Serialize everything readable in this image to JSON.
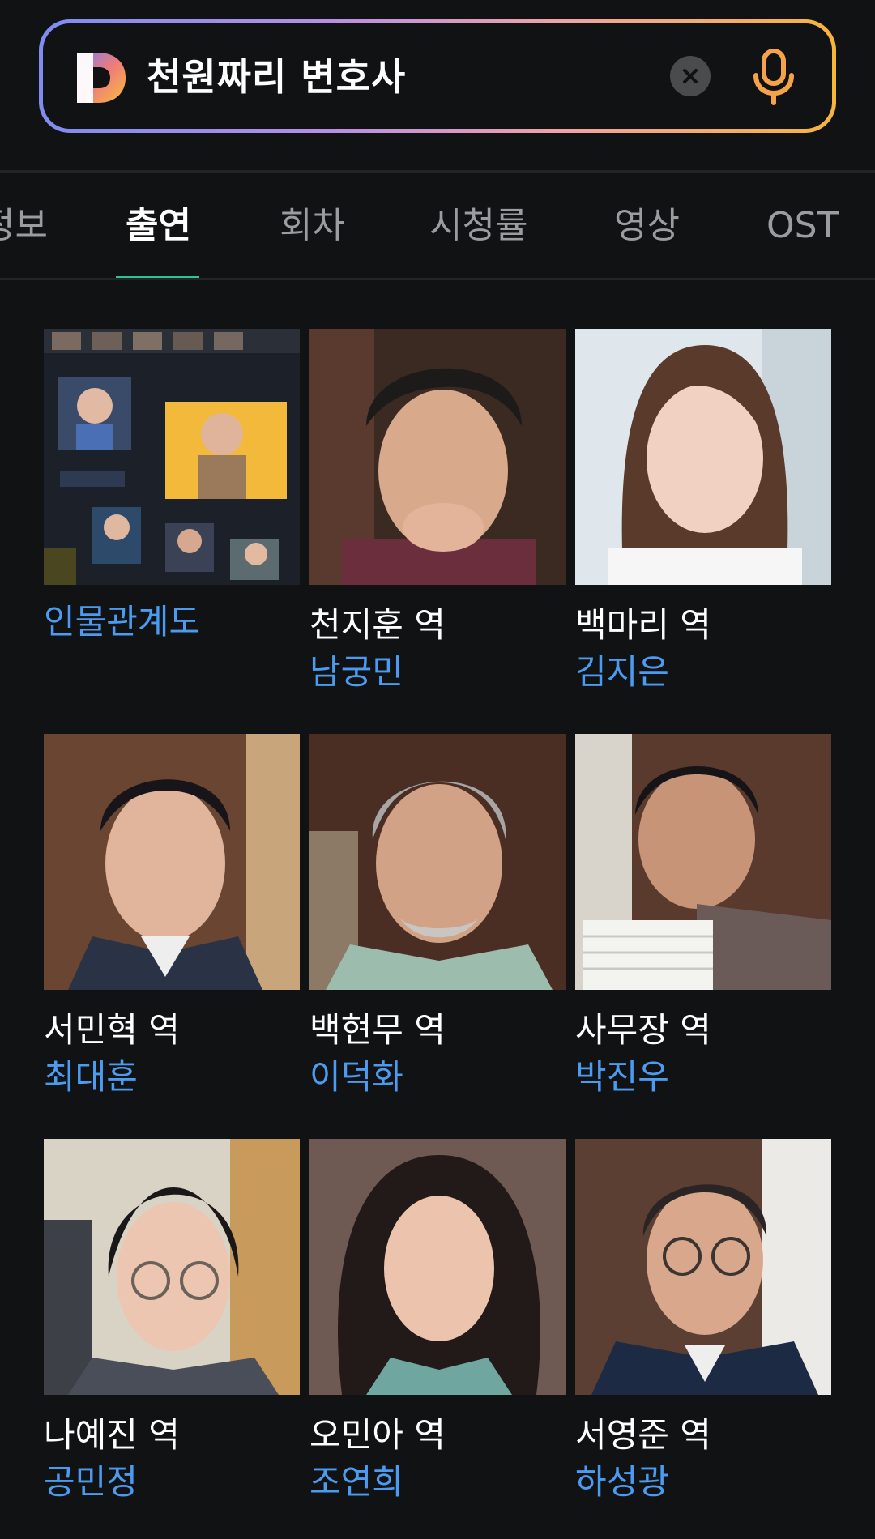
{
  "search": {
    "query": "천원짜리 변호사",
    "brand_colors": [
      "#7f8cf0",
      "#b58ee8",
      "#f0a2a8",
      "#f6b53c"
    ],
    "logo_icon": "daum-d-logo",
    "clear_icon": "close-icon",
    "mic_icon": "microphone-icon"
  },
  "tabs": [
    {
      "label": "정보",
      "active": false
    },
    {
      "label": "출연",
      "active": true
    },
    {
      "label": "회차",
      "active": false
    },
    {
      "label": "시청률",
      "active": false
    },
    {
      "label": "영상",
      "active": false
    },
    {
      "label": "OST",
      "active": false
    }
  ],
  "accent_color": "#2ec38f",
  "link_color": "#4b9bf0",
  "relationship_chart": {
    "label": "인물관계도"
  },
  "cast": [
    {
      "role": "천지훈 역",
      "actor": "남궁민"
    },
    {
      "role": "백마리 역",
      "actor": "김지은"
    },
    {
      "role": "서민혁 역",
      "actor": "최대훈"
    },
    {
      "role": "백현무 역",
      "actor": "이덕화"
    },
    {
      "role": "사무장 역",
      "actor": "박진우"
    },
    {
      "role": "나예진 역",
      "actor": "공민정"
    },
    {
      "role": "오민아 역",
      "actor": "조연희"
    },
    {
      "role": "서영준 역",
      "actor": "하성광"
    }
  ]
}
